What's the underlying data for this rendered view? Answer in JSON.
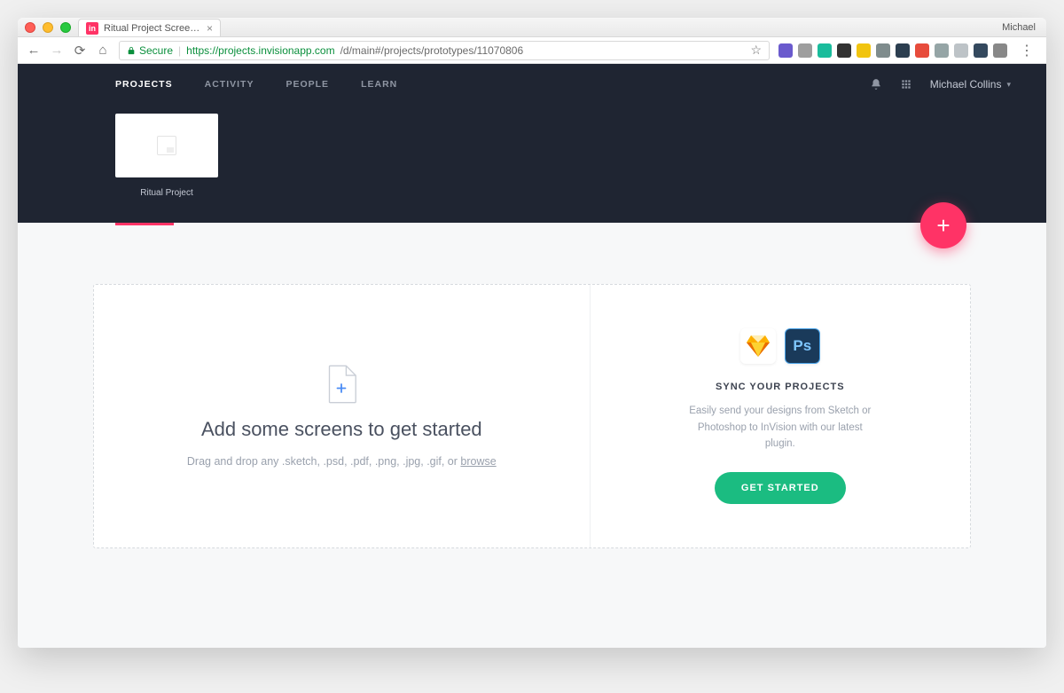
{
  "browser": {
    "profile": "Michael",
    "tab": {
      "title": "Ritual Project Screens - InVisio",
      "favicon_text": "in"
    },
    "secure_label": "Secure",
    "url_host": "https://projects.invisionapp.com",
    "url_path": "/d/main#/projects/prototypes/11070806"
  },
  "app": {
    "nav": {
      "projects": "PROJECTS",
      "activity": "ACTIVITY",
      "people": "PEOPLE",
      "learn": "LEARN"
    },
    "user": "Michael Collins",
    "project_name": "Ritual Project"
  },
  "dropzone": {
    "title": "Add some screens to get started",
    "subtitle_prefix": "Drag and drop any .sketch, .psd, .pdf, .png, .jpg, .gif, or ",
    "browse": "browse"
  },
  "sync": {
    "title": "SYNC YOUR PROJECTS",
    "desc": "Easily send your designs from Sketch or Photoshop to InVision with our latest plugin.",
    "cta": "GET STARTED"
  },
  "fab_label": "+"
}
